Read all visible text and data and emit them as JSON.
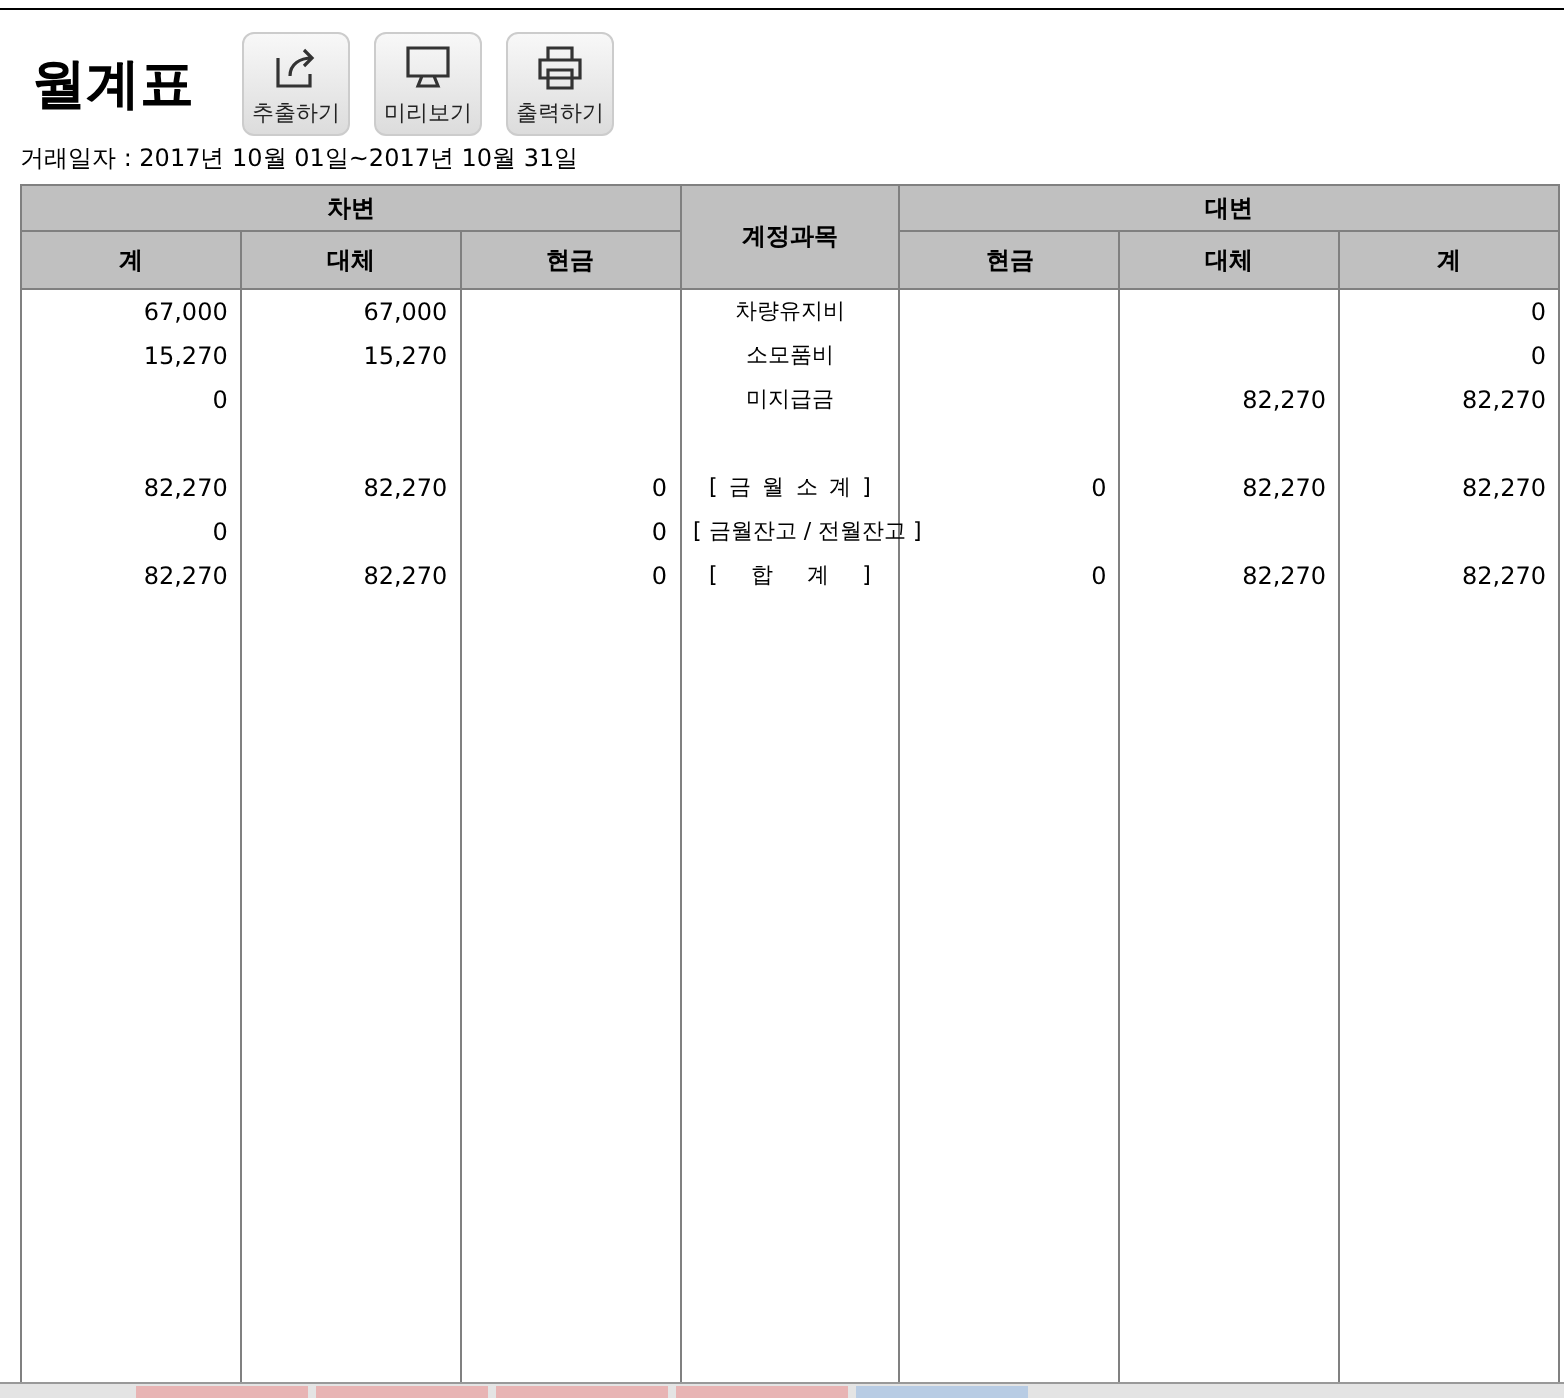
{
  "title": "월계표",
  "toolbar": [
    {
      "kind": "export",
      "label": "추출하기"
    },
    {
      "kind": "preview",
      "label": "미리보기"
    },
    {
      "kind": "print",
      "label": "출력하기"
    }
  ],
  "date_range": "거래일자 : 2017년 10월 01일~2017년 10월 31일",
  "table": {
    "debit_group": "차변",
    "credit_group": "대변",
    "account_header": "계정과목",
    "debit_columns": [
      "계",
      "대체",
      "현금"
    ],
    "credit_columns": [
      "현금",
      "대체",
      "계"
    ],
    "rows": [
      {
        "kind": "account",
        "debit_total": "67,000",
        "debit_transfer": "67,000",
        "account": "차량유지비",
        "credit_total": "0"
      },
      {
        "kind": "account",
        "debit_total": "15,270",
        "debit_transfer": "15,270",
        "account": "소모품비",
        "credit_total": "0"
      },
      {
        "kind": "account",
        "debit_total": "0",
        "account": "미지급금",
        "credit_transfer": "82,270",
        "credit_total": "82,270"
      },
      {
        "kind": "blank"
      },
      {
        "kind": "total",
        "spread": true,
        "debit_total": "82,270",
        "debit_transfer": "82,270",
        "debit_cash": "0",
        "account": "[ 금 월 소 계 ]",
        "credit_cash": "0",
        "credit_transfer": "82,270",
        "credit_total": "82,270"
      },
      {
        "kind": "total",
        "spread": false,
        "debit_total": "0",
        "debit_cash": "0",
        "account": "[ 금월잔고 / 전월잔고 ]"
      },
      {
        "kind": "total",
        "spread": true,
        "debit_total": "82,270",
        "debit_transfer": "82,270",
        "debit_cash": "0",
        "account": "[ 합 계 ]",
        "credit_cash": "0",
        "credit_transfer": "82,270",
        "credit_total": "82,270"
      }
    ]
  },
  "bottom_tabs": [
    {
      "color": "#e8b4b4"
    },
    {
      "color": "#e8b4b4"
    },
    {
      "color": "#e8b4b4"
    },
    {
      "color": "#e8b4b4"
    },
    {
      "color": "#b8cce4"
    }
  ]
}
